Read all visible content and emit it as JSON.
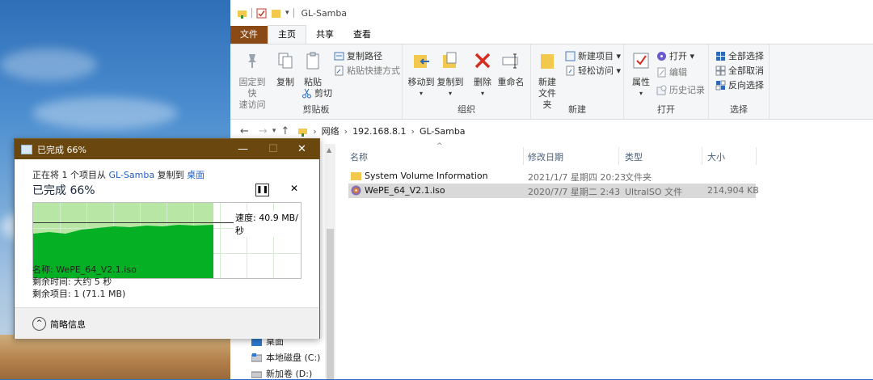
{
  "explorer": {
    "title": "GL-Samba",
    "tabs": [
      "文件",
      "主页",
      "共享",
      "查看"
    ],
    "ribbon": {
      "clipboard": {
        "pin_label": "固定到快\n速访问",
        "copy_label": "复制",
        "paste_label": "粘贴",
        "copy_path": "复制路径",
        "paste_shortcut": "粘贴快捷方式",
        "cut": "剪切",
        "group": "剪贴板"
      },
      "organize": {
        "move_to": "移动到",
        "copy_to": "复制到",
        "delete": "删除",
        "rename": "重命名",
        "group": "组织"
      },
      "new": {
        "new_folder": "新建\n文件夹",
        "new_item": "新建项目 ▾",
        "easy_access": "轻松访问 ▾",
        "group": "新建"
      },
      "open": {
        "properties": "属性",
        "open": "打开 ▾",
        "edit": "编辑",
        "history": "历史记录",
        "group": "打开"
      },
      "select": {
        "select_all": "全部选择",
        "select_none": "全部取消",
        "invert": "反向选择",
        "group": "选择"
      }
    },
    "breadcrumb": [
      "网络",
      "192.168.8.1",
      "GL-Samba"
    ],
    "columns": {
      "name": "名称",
      "date": "修改日期",
      "type": "类型",
      "size": "大小"
    },
    "files": [
      {
        "name": "System Volume Information",
        "date": "2021/1/7 星期四 20:23",
        "type": "文件夹",
        "size": ""
      },
      {
        "name": "WePE_64_V2.1.iso",
        "date": "2020/7/7 星期二 2:43",
        "type": "UltraISO 文件",
        "size": "214,904 KB"
      }
    ],
    "nav": [
      "桌面",
      "本地磁盘 (C:)",
      "新加卷 (D:)"
    ]
  },
  "dialog": {
    "title": "已完成 66%",
    "line_prefix": "正在将 1 个项目从 ",
    "source": "GL-Samba",
    "line_mid": " 复制到 ",
    "dest": "桌面",
    "heading": "已完成 66%",
    "progress_pct": 66,
    "speed": "速度: 40.9 MB/秒",
    "name_line": "名称: WePE_64_V2.1.iso",
    "time_line": "剩余时间: 大约 5 秒",
    "items_line": "剩余项目: 1 (71.1 MB)",
    "details_label": "简略信息"
  },
  "colors": {
    "dialog_title": "#6a470e",
    "progress_fill": "#06b025",
    "progress_done_bg": "#b7e6a5",
    "link": "#1f5fc8"
  }
}
